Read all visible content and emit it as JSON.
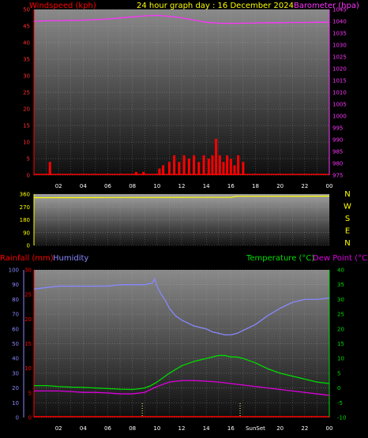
{
  "header": {
    "wind_title": "Windspeed (kph)",
    "main_title": "24 hour graph day : 16 December 2024",
    "baro_title": "Barometer (hpa)",
    "rain_title": "Rainfall (mm)",
    "hum_title": "Humidity",
    "temp_title": "Temperature (°C)",
    "dew_title": "Dew Point (°C)"
  },
  "colors": {
    "wind": "#ff0000",
    "baro": "#ff33ff",
    "dir": "#ffff00",
    "hum": "#8888ff",
    "temp": "#00dd00",
    "dew": "#dd00dd",
    "rain": "#ff0000",
    "axis_text": "#ff3030",
    "plot_top": "#858585",
    "plot_bottom": "#101010"
  },
  "chart_data": [
    {
      "type": "line",
      "title": "24 hour graph day : 16 December 2024",
      "ylabel": "Windspeed (kph)",
      "y2label": "Barometer (hpa)",
      "x_ticks": [
        "02",
        "04",
        "06",
        "08",
        "10",
        "12",
        "14",
        "16",
        "18",
        "20",
        "22",
        "00"
      ],
      "ylim": [
        0,
        50
      ],
      "y_ticks": [
        "0",
        "5",
        "10",
        "15",
        "20",
        "25",
        "30",
        "35",
        "40",
        "45",
        "50"
      ],
      "y2lim": [
        975,
        1045
      ],
      "y2_ticks": [
        "975",
        "980",
        "985",
        "990",
        "995",
        "1000",
        "1005",
        "1010",
        "1015",
        "1020",
        "1025",
        "1030",
        "1035",
        "1040",
        "1045"
      ],
      "series": [
        {
          "name": "Barometer (hpa)",
          "x": [
            0,
            1,
            2,
            3,
            4,
            5,
            6,
            7,
            8,
            9,
            10,
            11,
            12,
            13,
            14,
            15,
            16,
            17,
            18,
            19,
            20,
            21,
            22,
            23,
            24
          ],
          "values": [
            1040.0,
            1040.2,
            1040.3,
            1040.4,
            1040.5,
            1040.7,
            1041.0,
            1041.4,
            1041.9,
            1042.3,
            1042.5,
            1042.1,
            1041.5,
            1040.5,
            1039.6,
            1039.2,
            1039.1,
            1039.2,
            1039.3,
            1039.4,
            1039.4,
            1039.5,
            1039.5,
            1039.6,
            1039.6
          ]
        },
        {
          "name": "Windspeed (kph)",
          "x": [
            1.3,
            8.3,
            8.9,
            10.2,
            10.5,
            11.0,
            11.4,
            11.8,
            12.2,
            12.6,
            13.0,
            13.4,
            13.8,
            14.2,
            14.5,
            14.8,
            15.1,
            15.4,
            15.7,
            16.0,
            16.3,
            16.6,
            17.0
          ],
          "values": [
            4,
            1,
            1,
            2,
            3,
            4,
            6,
            4,
            6,
            5,
            6,
            4,
            6,
            5,
            6,
            11,
            6,
            4,
            6,
            5,
            3,
            6,
            4
          ]
        }
      ]
    },
    {
      "type": "line",
      "ylabel": "Wind direction",
      "ylim": [
        0,
        360
      ],
      "y_ticks": [
        "0",
        "90",
        "180",
        "270",
        "360"
      ],
      "compass": [
        "N",
        "W",
        "S",
        "E",
        "N"
      ],
      "series": [
        {
          "name": "Wind direction",
          "x": [
            0,
            6,
            12,
            16,
            16.5,
            20,
            24
          ],
          "values": [
            335,
            336,
            337,
            338,
            345,
            345,
            346
          ]
        }
      ]
    },
    {
      "type": "line",
      "ylabel": "Rainfall (mm)",
      "y2label": "Temperature (°C)",
      "x_ticks": [
        "02",
        "04",
        "06",
        "08",
        "10",
        "12",
        "14",
        "16",
        "SunSet",
        "20",
        "22",
        "00"
      ],
      "hum_ticks": [
        "0",
        "10",
        "20",
        "30",
        "40",
        "50",
        "60",
        "70",
        "80",
        "90",
        "100"
      ],
      "rain_ticks": [
        "0",
        "5",
        "10",
        "15",
        "20",
        "25",
        "30"
      ],
      "temp_ticks": [
        "-10",
        "-5",
        "0",
        "5",
        "10",
        "15",
        "20",
        "25",
        "30",
        "35",
        "40"
      ],
      "hum_lim": [
        0,
        100
      ],
      "rain_lim": [
        0,
        30
      ],
      "temp_lim": [
        -10,
        40
      ],
      "sunrise_hour": 8.8,
      "sunset_hour": 16.75,
      "series": [
        {
          "name": "Humidity",
          "x": [
            0,
            1,
            2,
            3,
            4,
            5,
            6,
            7,
            8,
            9,
            9.6,
            9.8,
            10.0,
            10.3,
            10.7,
            11,
            11.5,
            12,
            12.5,
            13,
            13.5,
            14,
            14.5,
            15,
            15.5,
            16,
            16.5,
            17,
            17.5,
            18,
            19,
            20,
            21,
            22,
            23,
            24
          ],
          "values": [
            87,
            88,
            89,
            89,
            89,
            89,
            89,
            90,
            90,
            90,
            91,
            94,
            89,
            84,
            79,
            74,
            69,
            66,
            64,
            62,
            61,
            60,
            58,
            57,
            56,
            56,
            57,
            59,
            61,
            63,
            69,
            74,
            78,
            80,
            80,
            81
          ]
        },
        {
          "name": "Temperature (°C)",
          "x": [
            0,
            1,
            2,
            3,
            4,
            5,
            6,
            7,
            8,
            8.5,
            9,
            9.5,
            10,
            11,
            12,
            13,
            14,
            15,
            15.5,
            16,
            16.5,
            17,
            18,
            19,
            20,
            21,
            22,
            23,
            24
          ],
          "values": [
            0.8,
            0.8,
            0.5,
            0.3,
            0.2,
            0,
            -0.2,
            -0.4,
            -0.5,
            -0.3,
            0,
            0.8,
            2,
            5,
            7.5,
            9,
            10,
            11,
            11,
            10.5,
            10.5,
            10,
            8.5,
            6.5,
            5,
            4,
            3,
            2,
            1.5
          ]
        },
        {
          "name": "Dew Point (°C)",
          "x": [
            0,
            1,
            2,
            3,
            4,
            5,
            6,
            7,
            8,
            9,
            10,
            11,
            12,
            13,
            14,
            15,
            16,
            17,
            18,
            19,
            20,
            21,
            22,
            23,
            24
          ],
          "values": [
            -1,
            -1,
            -1,
            -1.2,
            -1.5,
            -1.5,
            -1.7,
            -2,
            -2,
            -1.5,
            0.5,
            2,
            2.5,
            2.5,
            2.3,
            2,
            1.5,
            1,
            0.5,
            0,
            -0.5,
            -1,
            -1.5,
            -2,
            -2.5
          ]
        },
        {
          "name": "Rainfall (mm)",
          "x": [
            0,
            24
          ],
          "values": [
            0,
            0
          ]
        }
      ]
    }
  ]
}
